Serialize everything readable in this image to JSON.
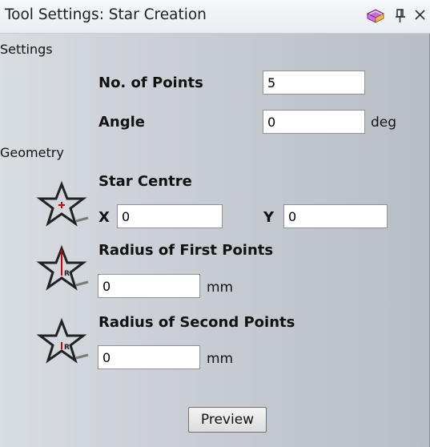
{
  "window": {
    "title": "Tool Settings: Star Creation",
    "icons": [
      "book-icon",
      "pin-icon",
      "close-icon"
    ],
    "close_glyph": "×",
    "pin_glyph": "ꟸ"
  },
  "settings": {
    "section_label": "Settings",
    "points_label": "No. of Points",
    "points_value": "5",
    "angle_label": "Angle",
    "angle_value": "0",
    "angle_unit": "deg"
  },
  "geometry": {
    "section_label": "Geometry",
    "centre_label": "Star Centre",
    "x_label": "X",
    "x_value": "0",
    "y_label": "Y",
    "y_value": "0",
    "first_radius_label": "Radius of First Points",
    "first_radius_value": "0",
    "first_radius_unit": "mm",
    "second_radius_label": "Radius of Second Points",
    "second_radius_value": "0",
    "second_radius_unit": "mm",
    "star_icon_glyph": "R"
  },
  "actions": {
    "preview_label": "Preview"
  },
  "colors": {
    "accent_red": "#d40000"
  }
}
